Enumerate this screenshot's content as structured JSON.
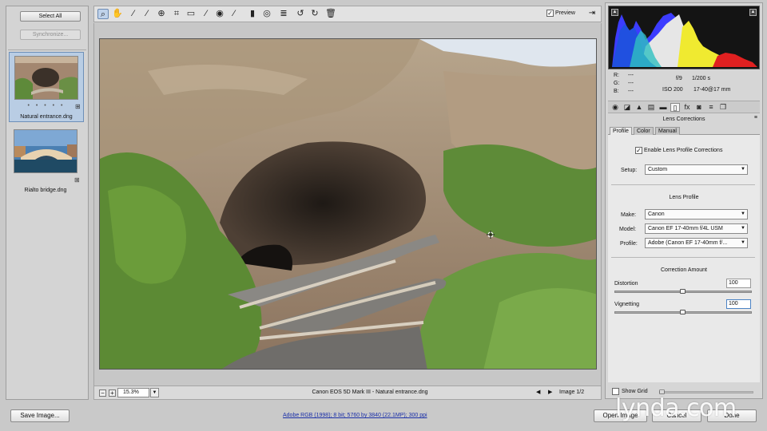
{
  "filmstrip": {
    "select_all": "Select All",
    "synchronize": "Synchronize...",
    "thumbnails": [
      {
        "name": "Natural entrance.dng",
        "stars": "• • • • •",
        "selected": true
      },
      {
        "name": "Rialto bridge.dng",
        "stars": "",
        "selected": false
      }
    ]
  },
  "toolbar": {
    "tools": [
      "zoom-icon",
      "hand-icon",
      "white-balance-icon",
      "color-sampler-icon",
      "targeted-adjustment-icon",
      "crop-icon",
      "straighten-icon",
      "spot-removal-icon",
      "red-eye-icon",
      "adjustment-brush-icon",
      "graduated-filter-icon",
      "radial-filter-icon",
      "preferences-icon",
      "rotate-ccw-icon",
      "rotate-cw-icon",
      "trash-icon"
    ],
    "preview_label": "Preview",
    "preview_checked": true
  },
  "status": {
    "zoom": "15.3%",
    "file_info": "Canon EOS 5D Mark III  -  Natural entrance.dng",
    "image_count": "Image 1/2"
  },
  "info": {
    "r_label": "R:",
    "g_label": "G:",
    "b_label": "B:",
    "r_value": "---",
    "g_value": "---",
    "b_value": "---",
    "aperture": "f/9",
    "shutter": "1/200 s",
    "iso": "ISO 200",
    "lens": "17-40@17 mm"
  },
  "panel": {
    "title": "Lens Corrections",
    "tabs": [
      "Profile",
      "Color",
      "Manual"
    ],
    "active_tab": "Profile",
    "enable_label": "Enable Lens Profile Corrections",
    "enable_checked": true,
    "setup_label": "Setup:",
    "setup_value": "Custom",
    "lens_profile_heading": "Lens Profile",
    "make_label": "Make:",
    "make_value": "Canon",
    "model_label": "Model:",
    "model_value": "Canon EF 17-40mm f/4L USM",
    "profile_label": "Profile:",
    "profile_value": "Adobe (Canon EF 17-40mm f/...",
    "correction_heading": "Correction Amount",
    "distortion_label": "Distortion",
    "distortion_value": "100",
    "vignetting_label": "Vignetting",
    "vignetting_value": "100",
    "show_grid_label": "Show Grid",
    "show_grid_checked": false
  },
  "bottom": {
    "save_image": "Save Image...",
    "workflow": "Adobe RGB (1998); 8 bit; 5760 by 3840 (22.1MP); 300 ppi",
    "open_image": "Open Image",
    "cancel": "Cancel",
    "done": "Done"
  },
  "watermark": "lynda.com",
  "colors": {
    "accent": "#6c8bb4",
    "link": "#1a2fa8",
    "panel_bg": "#e9e9e9"
  }
}
